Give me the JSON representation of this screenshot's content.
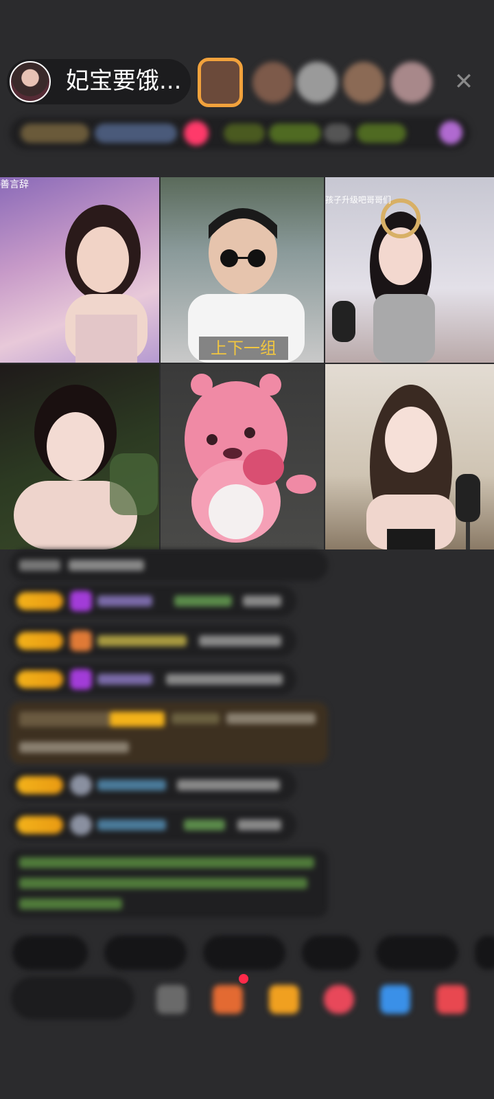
{
  "header": {
    "host_name": "妃宝要饿...",
    "close_icon": "close-icon"
  },
  "grid": {
    "tile1_caption": "善言辞",
    "tile2_caption": "上下一组",
    "tile3_caption": "孩子升级吧哥哥们"
  },
  "colors": {
    "background": "#2b2b2d",
    "badge": "#f3b21a",
    "highlight_row": "#3d3020"
  }
}
